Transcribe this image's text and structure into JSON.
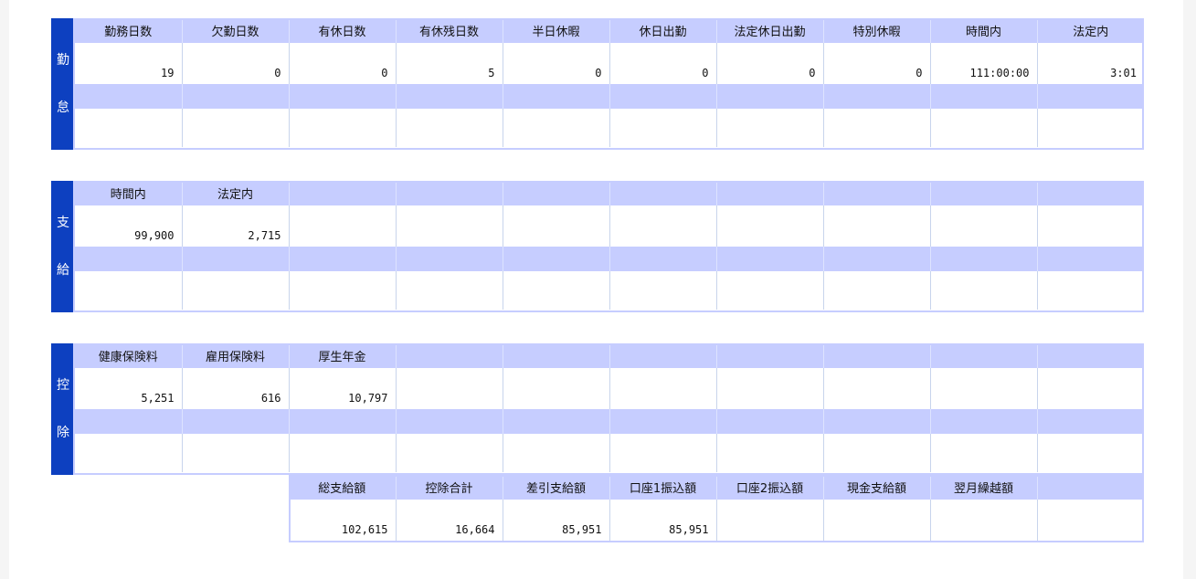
{
  "attendance": {
    "label_chars": [
      "勤",
      "怠"
    ],
    "headers": [
      "勤務日数",
      "欠勤日数",
      "有休日数",
      "有休残日数",
      "半日休暇",
      "休日出勤",
      "法定休日出勤",
      "特別休暇",
      "時間内",
      "法定内"
    ],
    "values": [
      "19",
      "0",
      "0",
      "5",
      "0",
      "0",
      "0",
      "0",
      "111:00:00",
      "3:01"
    ]
  },
  "payment": {
    "label_chars": [
      "支",
      "給"
    ],
    "headers": [
      "時間内",
      "法定内",
      "",
      "",
      "",
      "",
      "",
      "",
      "",
      ""
    ],
    "values": [
      "99,900",
      "2,715",
      "",
      "",
      "",
      "",
      "",
      "",
      "",
      ""
    ]
  },
  "deduction": {
    "label_chars": [
      "控",
      "除"
    ],
    "headers": [
      "健康保険料",
      "雇用保険料",
      "厚生年金",
      "",
      "",
      "",
      "",
      "",
      "",
      ""
    ],
    "values": [
      "5,251",
      "616",
      "10,797",
      "",
      "",
      "",
      "",
      "",
      "",
      ""
    ]
  },
  "totals": {
    "headers": [
      "総支給額",
      "控除合計",
      "差引支給額",
      "口座1振込額",
      "口座2振込額",
      "現金支給額",
      "翌月繰越額",
      ""
    ],
    "values": [
      "102,615",
      "16,664",
      "85,951",
      "85,951",
      "",
      "",
      "",
      ""
    ]
  },
  "colors": {
    "label_bg": "#0d40c0",
    "header_bg": "#c6cdff",
    "cell_bg": "#ffffff",
    "page_bg": "#f5f5f5"
  }
}
